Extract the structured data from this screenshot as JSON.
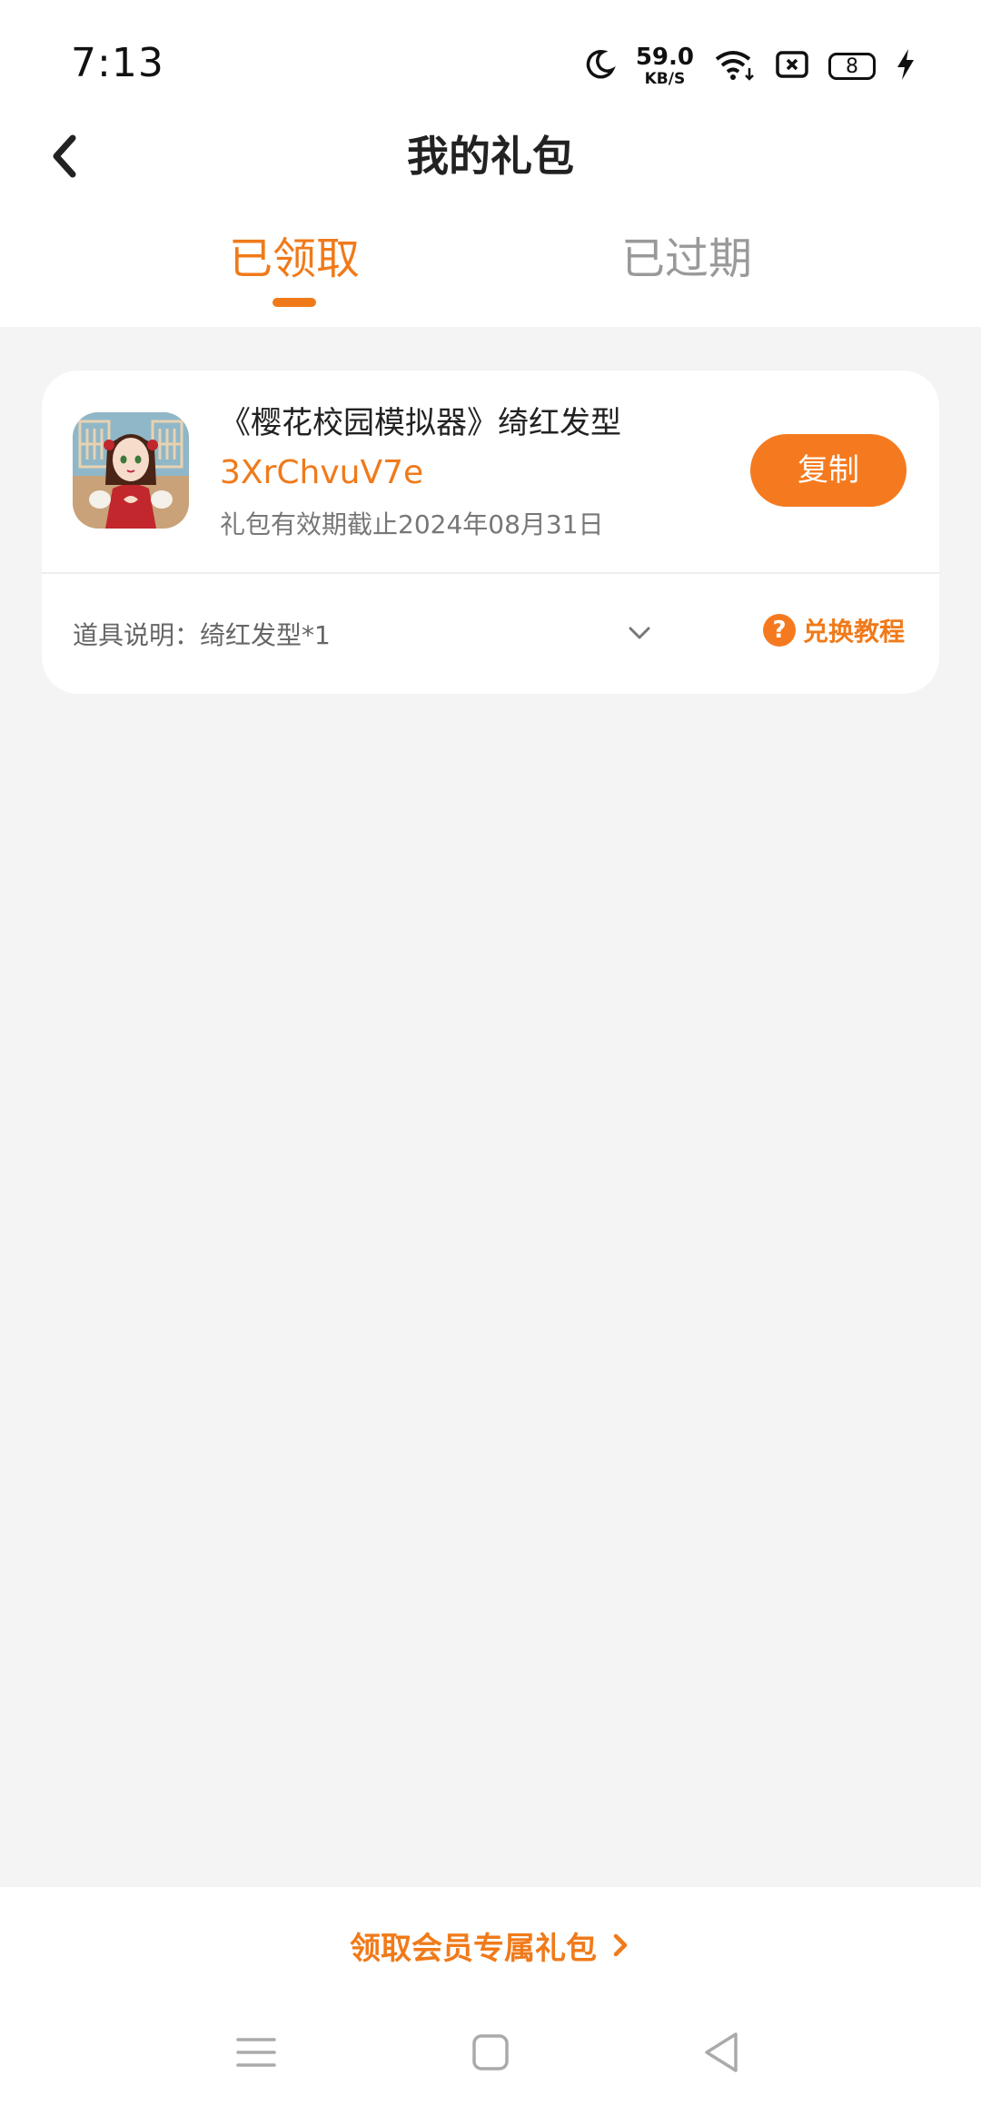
{
  "status_bar": {
    "time": "7:13",
    "net_speed_value": "59.0",
    "net_speed_unit": "KB/S",
    "battery_level": "8",
    "icons": [
      "moon-icon",
      "wifi-icon",
      "sim-blocked-icon",
      "battery-icon",
      "charging-bolt-icon"
    ]
  },
  "header": {
    "title": "我的礼包",
    "back_icon": "chevron-left-icon"
  },
  "tabs": [
    {
      "label": "已领取",
      "active": true
    },
    {
      "label": "已过期",
      "active": false
    }
  ],
  "gift": {
    "title": "《樱花校园模拟器》绮红发型",
    "code": "3XrChvuV7e",
    "expiry": "礼包有效期截止2024年08月31日",
    "copy_label": "复制",
    "item_description": "道具说明：绮红发型*1",
    "tutorial_label": "兑换教程",
    "tutorial_icon_glyph": "?"
  },
  "footer": {
    "vip_label": "领取会员专属礼包"
  },
  "colors": {
    "accent": "#f07a1a",
    "button": "#f57a1f",
    "background": "#f4f4f4"
  }
}
